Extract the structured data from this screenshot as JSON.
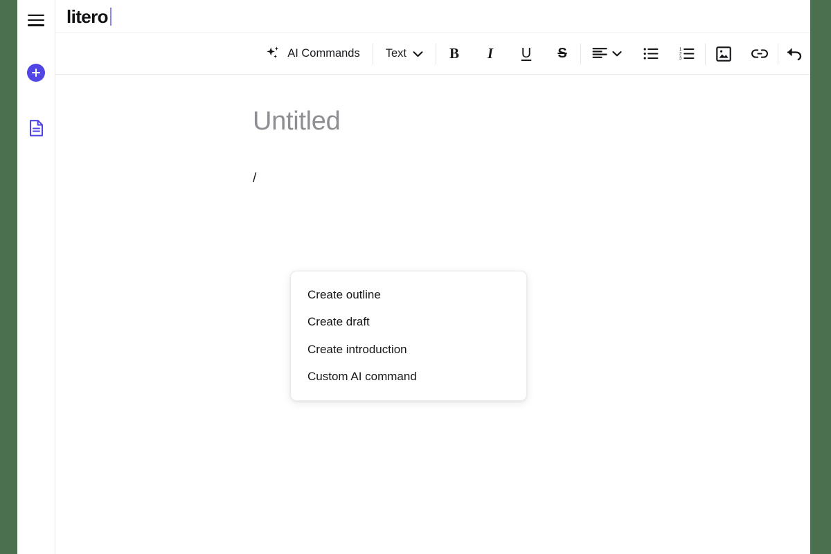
{
  "window": {
    "page_background_color": "#4a7050",
    "app_background_color": "#ffffff",
    "accent_color": "#4f46e5",
    "caret_color": "#8b85f0"
  },
  "sidebar": {
    "items": [
      {
        "name": "menu-toggle",
        "icon": "hamburger-icon",
        "label": "Menu"
      },
      {
        "name": "new-document",
        "icon": "plus-icon",
        "label": "New"
      },
      {
        "name": "documents",
        "icon": "document-icon",
        "label": "Documents"
      }
    ]
  },
  "header": {
    "logo_text": "litero"
  },
  "toolbar": {
    "ai_commands": {
      "label": "AI Commands",
      "icon": "sparkles-icon"
    },
    "text_style": {
      "label": "Text",
      "icon": "chevron-down-icon"
    },
    "bold": {
      "label": "B",
      "icon": "bold-icon"
    },
    "italic": {
      "label": "I",
      "icon": "italic-icon"
    },
    "underline": {
      "label": "U",
      "icon": "underline-icon"
    },
    "strikethrough": {
      "label": "S",
      "icon": "strikethrough-icon"
    },
    "align": {
      "icon": "align-left-icon",
      "chevron": "chevron-down-icon"
    },
    "bullet_list": {
      "icon": "bullet-list-icon"
    },
    "numbered_list": {
      "icon": "numbered-list-icon"
    },
    "image": {
      "icon": "image-icon"
    },
    "link": {
      "icon": "link-icon"
    },
    "undo": {
      "icon": "undo-icon"
    }
  },
  "document": {
    "title_placeholder": "Untitled",
    "body_text": "/"
  },
  "slash_menu": {
    "items": [
      {
        "label": "Create outline"
      },
      {
        "label": "Create draft"
      },
      {
        "label": "Create introduction"
      },
      {
        "label": "Custom AI command"
      }
    ]
  }
}
